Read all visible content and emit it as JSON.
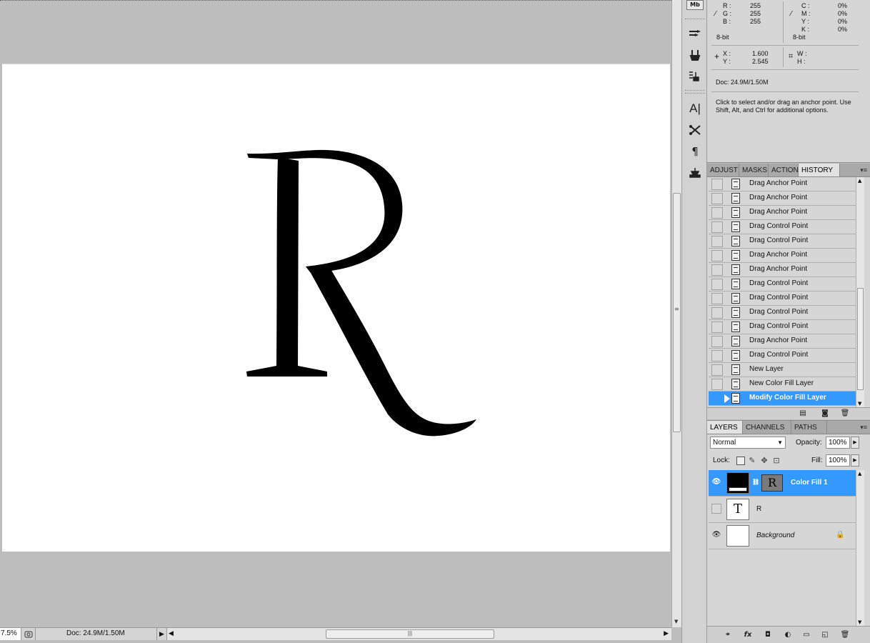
{
  "info": {
    "rgb": {
      "r_label": "R :",
      "r_value": "255",
      "g_label": "G :",
      "g_value": "255",
      "b_label": "B :",
      "b_value": "255",
      "bitdepth": "8-bit"
    },
    "cmyk": {
      "c_label": "C :",
      "c_value": "0%",
      "m_label": "M :",
      "m_value": "0%",
      "y_label": "Y :",
      "y_value": "0%",
      "k_label": "K :",
      "k_value": "0%",
      "bitdepth": "8-bit"
    },
    "position": {
      "x_label": "X :",
      "x_value": "1.600",
      "y_label": "Y :",
      "y_value": "2.545"
    },
    "size": {
      "w_label": "W :",
      "h_label": "H :"
    },
    "doc": "Doc: 24.9M/1.50M",
    "hint": "Click to select and/or drag an anchor point.  Use Shift, Alt, and Ctrl for additional options."
  },
  "history": {
    "tabs": [
      "ADJUST",
      "MASKS",
      "ACTION",
      "HISTORY"
    ],
    "active_tab": "HISTORY",
    "items": [
      "Drag Anchor Point",
      "Drag Anchor Point",
      "Drag Anchor Point",
      "Drag Control Point",
      "Drag Control Point",
      "Drag Anchor Point",
      "Drag Anchor Point",
      "Drag Control Point",
      "Drag Control Point",
      "Drag Control Point",
      "Drag Control Point",
      "Drag Anchor Point",
      "Drag Control Point",
      "New Layer",
      "New Color Fill Layer",
      "Modify Color Fill Layer"
    ],
    "selected_index": 15
  },
  "layers": {
    "tabs": [
      "LAYERS",
      "CHANNELS",
      "PATHS"
    ],
    "active_tab": "LAYERS",
    "blend_mode": "Normal",
    "opacity_label": "Opacity:",
    "opacity": "100%",
    "lock_label": "Lock:",
    "fill_label": "Fill:",
    "fill": "100%",
    "items": [
      {
        "name": "Color Fill 1",
        "visible": true,
        "selected": true
      },
      {
        "name": "R",
        "visible": false,
        "selected": false
      },
      {
        "name": "Background",
        "visible": true,
        "selected": false
      }
    ],
    "mask_letter": "R",
    "type_thumb": "T"
  },
  "status": {
    "zoom": "7.5%",
    "doc": "Doc: 24.9M/1.50M"
  },
  "tools": {
    "mb_badge": "Mb",
    "icons": [
      "brush-presets-icon",
      "clone-source-icon",
      "tool-presets-icon",
      "character-icon",
      "paragraph-styles-icon",
      "paragraph-icon",
      "notes-icon"
    ]
  },
  "colors": {
    "selection_blue": "#3399ff",
    "panel_gray": "#d6d6d6",
    "canvas_gray": "#bdbdbd",
    "glyph": "#000000"
  }
}
